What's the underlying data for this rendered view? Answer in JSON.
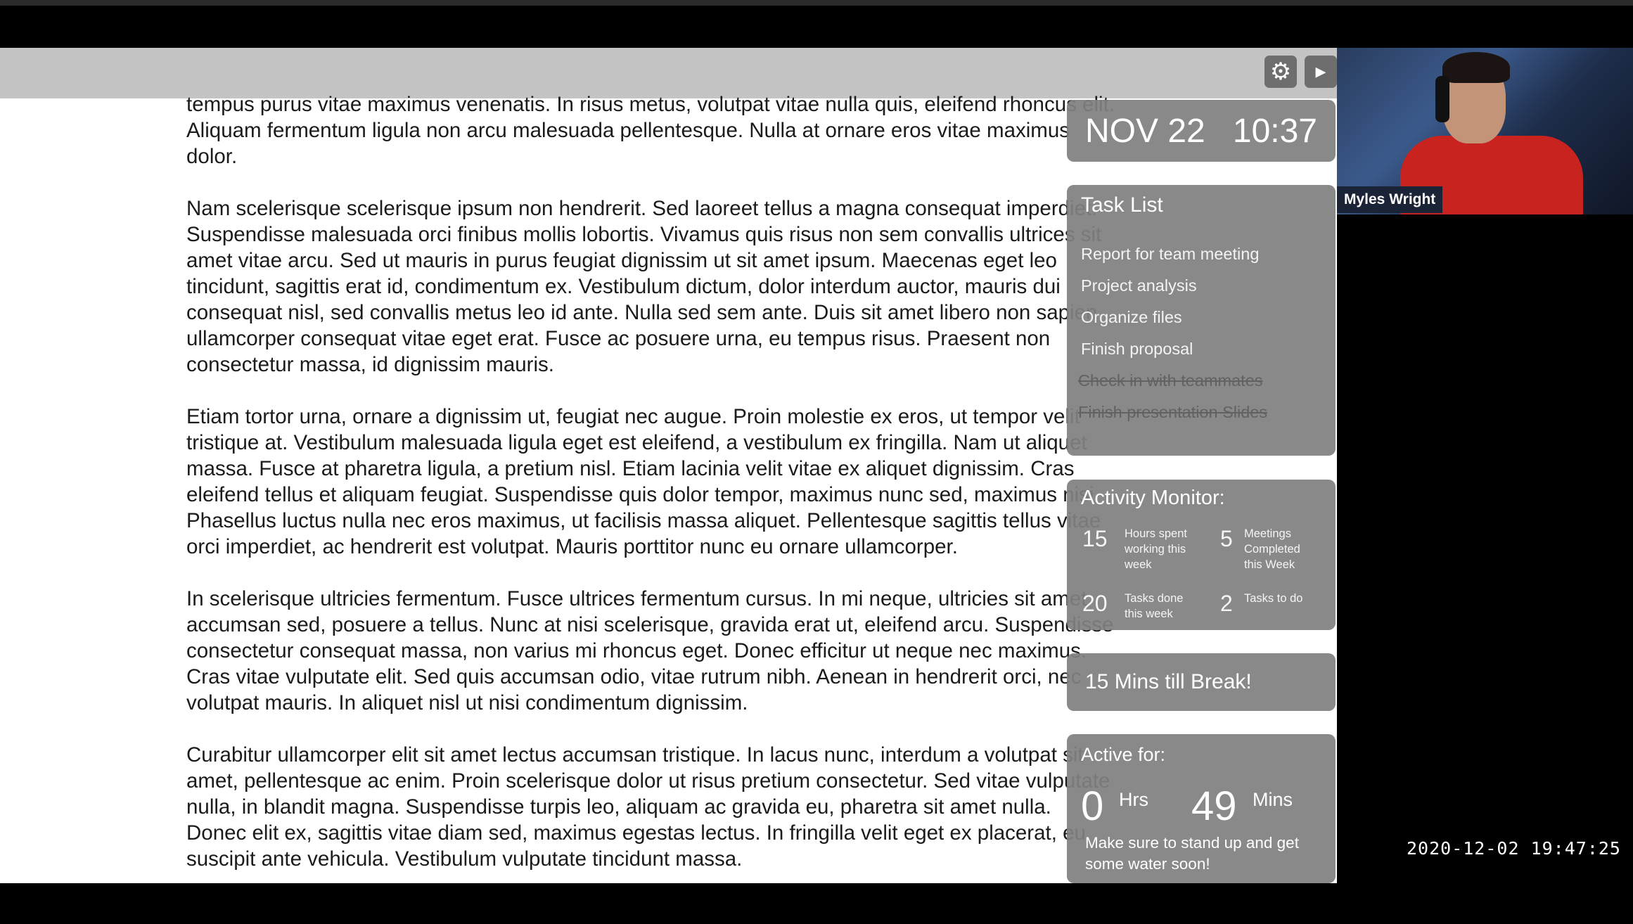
{
  "document": {
    "paragraphs": [
      "tempus purus vitae maximus venenatis. In risus metus, volutpat vitae nulla quis, eleifend rhoncus elit. Aliquam fermentum ligula non arcu malesuada pellentesque. Nulla at ornare eros vitae maximus dolor.",
      "Nam scelerisque scelerisque ipsum non hendrerit. Sed laoreet tellus a magna consequat imperdiet. Suspendisse malesuada orci finibus mollis lobortis. Vivamus quis risus non sem convallis ultrices sit amet vitae arcu. Sed ut mauris in purus feugiat dignissim ut sit amet ipsum. Maecenas eget leo tincidunt, sagittis erat id, condimentum ex. Vestibulum dictum, dolor interdum auctor, mauris dui consequat nisl, sed convallis metus leo id ante. Nulla sed sem ante. Duis sit amet libero non sapien ullamcorper consequat vitae eget erat. Fusce ac posuere urna, eu tempus risus. Praesent non consectetur massa, id dignissim mauris.",
      "Etiam tortor urna, ornare a dignissim ut, feugiat nec augue. Proin molestie ex eros, ut tempor velit tristique at. Vestibulum malesuada ligula eget est eleifend, a vestibulum ex fringilla. Nam ut aliquet massa. Fusce at pharetra ligula, a pretium nisl. Etiam lacinia velit vitae ex aliquet dignissim. Cras eleifend tellus et aliquam feugiat. Suspendisse quis dolor tempor, maximus nunc sed, maximus nisi. Phasellus luctus nulla nec eros maximus, ut facilisis massa aliquet. Pellentesque sagittis tellus vitae orci imperdiet, ac hendrerit est volutpat. Mauris porttitor nunc eu ornare ullamcorper.",
      "In scelerisque ultricies fermentum. Fusce ultrices fermentum cursus. In mi neque, ultricies sit amet accumsan sed, posuere a tellus. Nunc at nisi scelerisque, gravida erat ut, eleifend arcu. Suspendisse consectetur consequat massa, non varius mi rhoncus eget. Donec efficitur ut neque nec maximus. Cras vitae vulputate elit. Sed quis accumsan odio, vitae rutrum nibh. Aenean in hendrerit orci, nec volutpat mauris. In aliquet nisl ut nisi condimentum dignissim.",
      "Curabitur ullamcorper elit sit amet lectus accumsan tristique. In lacus nunc, interdum a volutpat sit amet, pellentesque ac enim. Proin scelerisque dolor ut risus pretium consectetur. Sed vitae vulputate nulla, in blandit magna. Suspendisse turpis leo, aliquam ac gravida eu, pharetra sit amet nulla. Donec elit ex, sagittis vitae diam sed, maximus egestas lectus. In fringilla velit eget ex placerat, eu suscipit ante vehicula. Vestibulum vulputate tincidunt massa."
    ]
  },
  "toolbar": {
    "settings_icon": "gear-icon",
    "collapse_icon": "collapse-icon"
  },
  "clock": {
    "date": "NOV 22",
    "time": "10:37"
  },
  "tasks": {
    "title": "Task List",
    "items": [
      {
        "label": "Report for team meeting",
        "done": false
      },
      {
        "label": "Project analysis",
        "done": false
      },
      {
        "label": "Organize files",
        "done": false
      },
      {
        "label": "Finish proposal",
        "done": false
      },
      {
        "label": "Check in with teammates",
        "done": true
      },
      {
        "label": "Finish presentation Slides",
        "done": true
      }
    ]
  },
  "activity": {
    "title": "Activity Monitor:",
    "stats": [
      {
        "value": "15",
        "label": "Hours spent working this week"
      },
      {
        "value": "5",
        "label": "Meetings Completed this Week"
      },
      {
        "value": "20",
        "label": "Tasks done this week"
      },
      {
        "value": "2",
        "label": "Tasks to do"
      }
    ]
  },
  "break": {
    "text": "15 Mins till Break!"
  },
  "active": {
    "label": "Active for:",
    "hours": "0",
    "hours_unit": "Hrs",
    "minutes": "49",
    "minutes_unit": "Mins",
    "reminder": "Make sure to stand up and get some water soon!"
  },
  "webcam": {
    "name": "Myles Wright"
  },
  "recording": {
    "timestamp": "2020-12-02 19:47:25"
  },
  "colors": {
    "widget_bg": "#808080",
    "toolbar_bg": "#c4c4c4",
    "shirt": "#c9231f"
  }
}
